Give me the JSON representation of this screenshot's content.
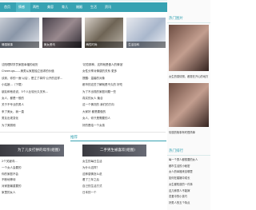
{
  "nav": [
    "首页",
    "情感",
    "两性",
    "美容",
    "育儿",
    "婚姻",
    "生活",
    "资讯"
  ],
  "thumbs": [
    "情感故事",
    "美女资讯",
    "两性时尚",
    "生活百科"
  ],
  "list_left": [
    "沈阳理财学员家庭幸福的经历",
    "Cheerugs——美男从家庭独立追求的价值",
    "谈到，你的一面'以后'，是立了事件'公开的这样...",
    "小姑娘...（下载）",
    "朋友和他说说，5个人比较长久关系...",
    "女人，都是一般的",
    "关于不专业的男人",
    "来了美女，我一直",
    "男友出现变化",
    "为了美丽他"
  ],
  "list_right": [
    "'初恋那种，这样就是做人的情谊'",
    "女性分享对情感的关系 更多",
    "提醒：温馨的对象",
    "都市的这些了解就是不久的 好吃",
    "为了不出现的家庭问题一些",
    "真实的女人 聚合",
    "这一个情况的 我们的方向",
    "大家好 都是要做的",
    "女人，你只是需要的人",
    "好的是给一个女孩"
  ],
  "section_title": "推荐",
  "feature_left": "为了儿女打拼的母亲(组图)",
  "feature_right": "二手男生被喜欢(组图)",
  "list_left2": [
    "2个关键词...",
    "一个女人会要的",
    "你的家庭不会",
    "不断地等待",
    "对家庭最重要的",
    "家里的女人"
  ],
  "list_right2": [
    "女生的每日生活",
    "为什么这样？",
    "这种感情怎么说",
    "看了三年之后",
    "自己的生活方式",
    "日本的一个"
  ],
  "side_title1": "热门图片",
  "side_title2": "热门排行",
  "side_caption": "女生的感情照，都是在开心的地方",
  "side_caption2": "情感的故事有时很简单",
  "side_hot": [
    "每一个男人都想要的女人",
    "都市生活的小秘密",
    "女人的幸福来自哪里",
    "如何在婚姻中成长",
    "女生都知道的一件事",
    "这几种男人不能嫁",
    "恋爱中的小技巧",
    "好男人的五个特点",
    "生活中最美好的",
    "相亲的注意事项"
  ]
}
